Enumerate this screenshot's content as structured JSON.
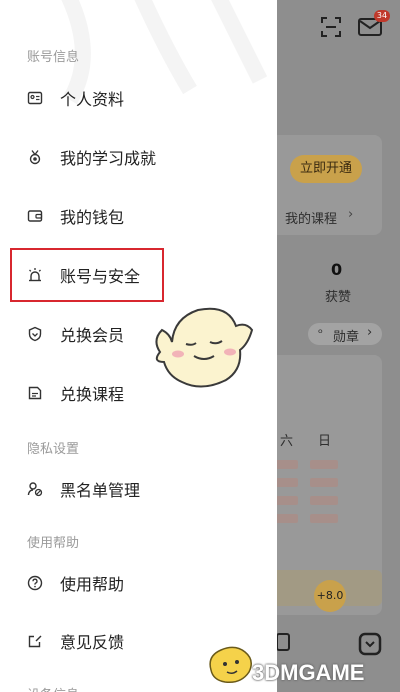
{
  "drawer": {
    "section_account": "账号信息",
    "section_privacy": "隐私设置",
    "section_help": "使用帮助",
    "section_device": "设备信息",
    "items": [
      {
        "label": "个人资料",
        "icon": "id-card-icon"
      },
      {
        "label": "我的学习成就",
        "icon": "medal-icon"
      },
      {
        "label": "我的钱包",
        "icon": "wallet-icon"
      },
      {
        "label": "账号与安全",
        "icon": "alarm-light-icon"
      },
      {
        "label": "兑换会员",
        "icon": "shield-badge-icon"
      },
      {
        "label": "兑换课程",
        "icon": "course-book-icon"
      },
      {
        "label": "黑名单管理",
        "icon": "user-block-icon"
      },
      {
        "label": "使用帮助",
        "icon": "help-circle-icon"
      },
      {
        "label": "意见反馈",
        "icon": "feedback-icon"
      }
    ]
  },
  "background": {
    "open_now": "立即开通",
    "my_courses": "我的课程",
    "likes_count": "0",
    "likes_label": "获赞",
    "medal_label": "勋章",
    "weekday_sat": "六",
    "weekday_sun": "日",
    "score": "+8.0",
    "message_badge": "34"
  },
  "watermark": {
    "brand": "3DMGAME"
  },
  "colors": {
    "highlight_border": "#d8272f",
    "accent_yellow": "#e8b64a"
  }
}
